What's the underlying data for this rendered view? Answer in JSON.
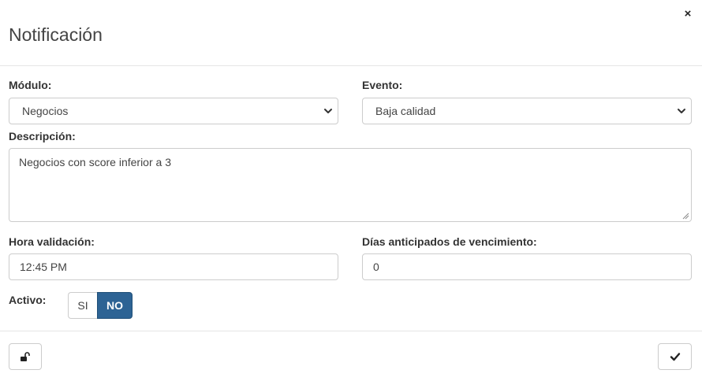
{
  "dialog": {
    "title": "Notificación",
    "close_glyph": "×"
  },
  "form": {
    "modulo": {
      "label": "Módulo:",
      "value": "Negocios"
    },
    "evento": {
      "label": "Evento:",
      "value": "Baja calidad"
    },
    "descripcion": {
      "label": "Descripción:",
      "value": "Negocios con score inferior a 3"
    },
    "hora": {
      "label": "Hora validación:",
      "value": "12:45 PM"
    },
    "dias": {
      "label": "Días anticipados de vencimiento:",
      "value": "0"
    },
    "activo": {
      "label": "Activo:",
      "options": [
        "SI",
        "NO"
      ],
      "selected": "NO"
    }
  },
  "footer": {
    "left_icon": "unlock-icon",
    "right_icon": "check-icon"
  },
  "colors": {
    "accent": "#2d6394",
    "border": "#cccccc"
  }
}
